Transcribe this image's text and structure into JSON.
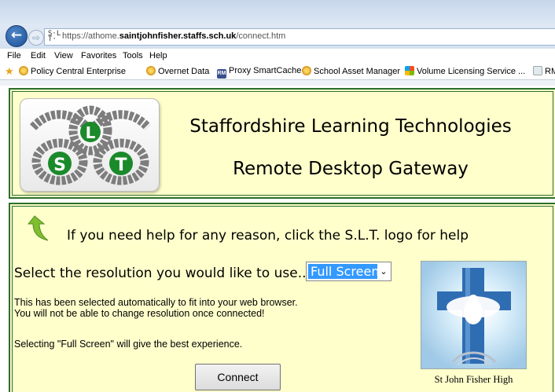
{
  "browser": {
    "url_prefix": "https://athome.",
    "url_domain": "saintjohnfisher.staffs.sch.uk",
    "url_path": "/connect.htm",
    "menu": [
      "File",
      "Edit",
      "View",
      "Favorites",
      "Tools",
      "Help"
    ],
    "favorites": [
      {
        "label": "Policy Central Enterprise",
        "icon": "ie-icon"
      },
      {
        "label": "Overnet Data",
        "icon": "ie-icon"
      },
      {
        "label": "Proxy SmartCache",
        "icon": "rm-icon"
      },
      {
        "label": "School Asset Manager",
        "icon": "ie-icon"
      },
      {
        "label": "Volume Licensing Service ...",
        "icon": "microsoft-icon"
      },
      {
        "label": "RM",
        "icon": "document-icon"
      }
    ],
    "rm_badge": "RM"
  },
  "header": {
    "title_line1": "Staffordshire Learning Technologies",
    "title_line2": "Remote Desktop Gateway",
    "logo_letters": {
      "top": "L",
      "left": "S",
      "right": "T"
    }
  },
  "main": {
    "help_text": "If you need help for any reason, click the S.L.T. logo for help",
    "resolution_label": "Select the resolution you would like to use...",
    "resolution_value": "Full Screen",
    "info_line1": "This has been selected automatically to fit into your web browser.",
    "info_line2": "You will not be able to change resolution once connected!",
    "info_line3": "Selecting \"Full Screen\" will give the best experience.",
    "connect_label": "Connect",
    "image_caption": "St John Fisher High"
  },
  "colors": {
    "panel_bg": "#ffffcc",
    "panel_border": "#2b6f2b",
    "select_highlight": "#3399ff"
  }
}
